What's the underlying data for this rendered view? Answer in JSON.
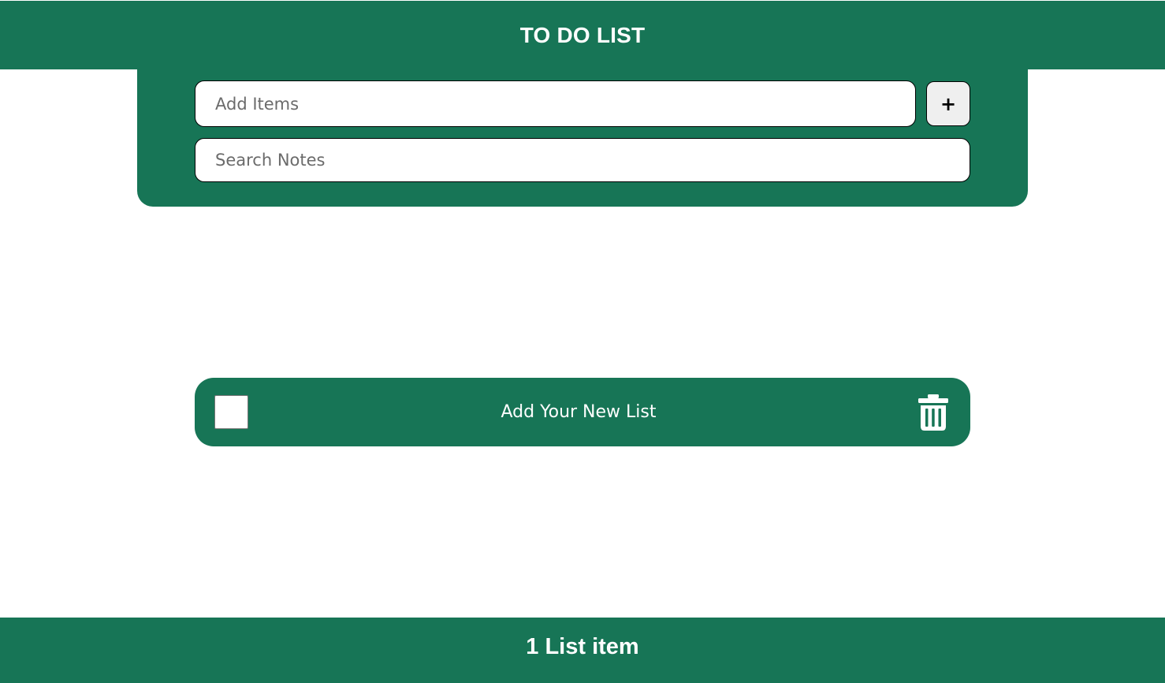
{
  "header": {
    "title": "TO DO LIST"
  },
  "add_form": {
    "add_input_placeholder": "Add Items",
    "add_input_value": "",
    "add_button_label": "+"
  },
  "search": {
    "placeholder": "Search Notes",
    "value": ""
  },
  "list": {
    "items": [
      {
        "text": "Add Your New List",
        "checked": false,
        "delete_icon": "trash-icon"
      }
    ]
  },
  "footer": {
    "count_text": "1 List item"
  },
  "colors": {
    "brand_green": "#177556",
    "background": "#ffffff",
    "button_bg": "#efefef"
  }
}
